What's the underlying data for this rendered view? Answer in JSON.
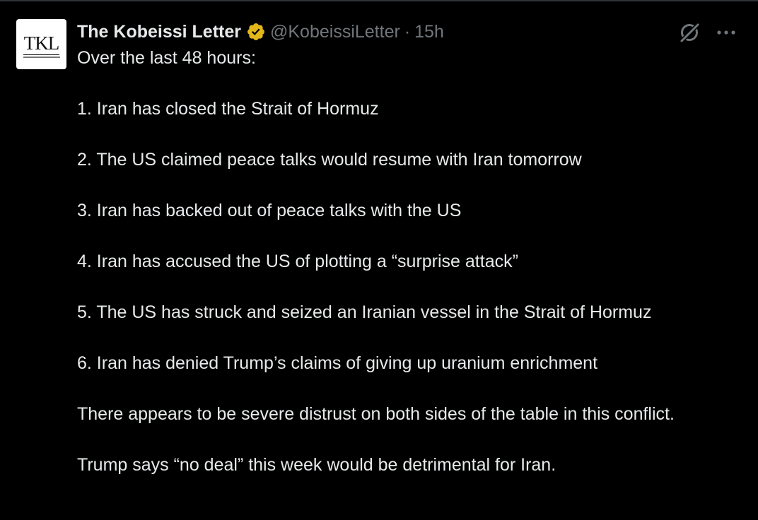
{
  "tweet": {
    "author": {
      "display_name": "The Kobeissi Letter",
      "handle": "@KobeissiLetter",
      "avatar_text": "TKL",
      "avatar_subtext": "THE KOBEISSI LETTER",
      "verified_icon": "verified-badge-gold",
      "verified_color": "#e2b719"
    },
    "separator": "·",
    "timestamp": "15h",
    "paragraphs": [
      "Over the last 48 hours:",
      "1. Iran has closed the Strait of Hormuz",
      "2. The US claimed peace talks would resume with Iran tomorrow",
      "3. Iran has backed out of peace talks with the US",
      "4. Iran has accused the US of plotting a “surprise attack”",
      "5. The US has struck and seized an Iranian vessel in the Strait of Hormuz",
      "6. Iran has denied Trump’s claims of giving up uranium enrichment",
      "There appears to be severe distrust on both sides of the table in this conflict.",
      "Trump says “no deal” this week would be detrimental for Iran."
    ],
    "actions": {
      "grok_icon": "grok-icon",
      "more_icon": "more-options-icon"
    }
  },
  "colors": {
    "background": "#000000",
    "text_primary": "#e7e9ea",
    "text_secondary": "#71767b",
    "divider": "#2f3336"
  }
}
